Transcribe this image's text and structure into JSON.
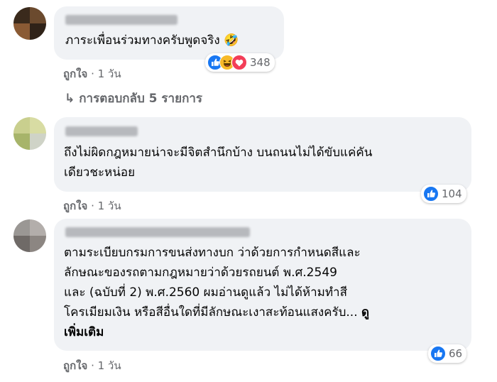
{
  "comments": [
    {
      "text_lines": [
        "ภาระเพื่อนร่วมทางครับพูดจริง 🤣"
      ],
      "reaction_count": "348",
      "reactions": [
        "like-icon",
        "haha-icon",
        "love-icon"
      ],
      "like_label": "ถูกใจ",
      "time": "1 วัน",
      "replies_label": "การตอบกลับ 5 รายการ"
    },
    {
      "text_lines": [
        "ถึงไม่ผิดกฎหมายน่าจะมีจิตสำนึกบ้าง บนถนนไม่ได้ขับแค่คัน",
        "เดียวชะหน่อย"
      ],
      "reaction_count": "104",
      "reactions": [
        "like-icon"
      ],
      "like_label": "ถูกใจ",
      "time": "1 วัน"
    },
    {
      "text_lines": [
        "ตามระเบียบกรมการขนส่งทางบก ว่าด้วยการกำหนดสีและ",
        "ลักษณะของรถตามกฎหมายว่าด้วยรถยนต์ พ.ศ.2549",
        "และ (ฉบับที่ 2) พ.ศ.2560 ผมอ่านดูแล้ว ไม่ได้ห้ามทำสี",
        "โครเมียมเงิน หรือสีอื่นใดที่มีลักษณะเงาสะท้อนแสงครับ... "
      ],
      "see_more_1": "ดู",
      "see_more_2": "เพิ่มเติม",
      "reaction_count": "66",
      "reactions": [
        "like-icon"
      ],
      "like_label": "ถูกใจ",
      "time": "1 วัน"
    }
  ],
  "meta_separator": "·",
  "reply_arrow": "↳",
  "colors": {
    "like_blue": "#1877f2",
    "haha_yellow": "#f7b928",
    "love_red": "#f33e58",
    "bubble": "#f0f2f5",
    "meta": "#65676b"
  }
}
